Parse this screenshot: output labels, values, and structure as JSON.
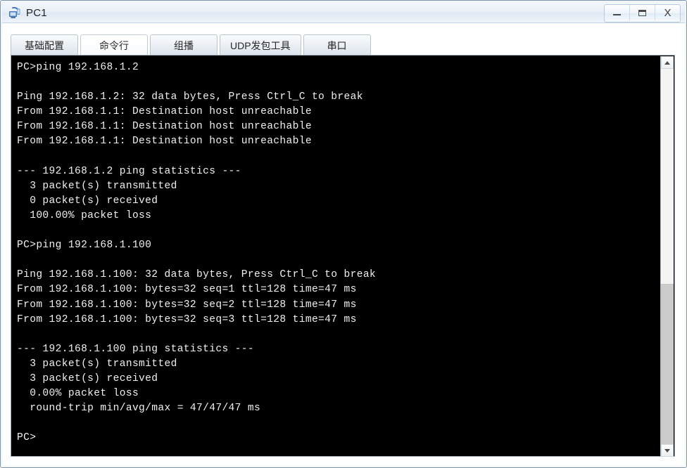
{
  "window": {
    "title": "PC1",
    "icon": "pc-terminal-icon",
    "controls": {
      "minimize": "–",
      "maximize": "❐",
      "close": "X"
    }
  },
  "tabs": [
    {
      "label": "基础配置",
      "name": "tab-basic-config",
      "selected": false
    },
    {
      "label": "命令行",
      "name": "tab-command-line",
      "selected": true
    },
    {
      "label": "组播",
      "name": "tab-multicast",
      "selected": false
    },
    {
      "label": "UDP发包工具",
      "name": "tab-udp-tool",
      "selected": false
    },
    {
      "label": "串口",
      "name": "tab-serial-port",
      "selected": false
    }
  ],
  "terminal": {
    "foreground": "#f0f0f0",
    "background": "#000000",
    "lines": [
      "PC>ping 192.168.1.2",
      "",
      "Ping 192.168.1.2: 32 data bytes, Press Ctrl_C to break",
      "From 192.168.1.1: Destination host unreachable",
      "From 192.168.1.1: Destination host unreachable",
      "From 192.168.1.1: Destination host unreachable",
      "",
      "--- 192.168.1.2 ping statistics ---",
      "  3 packet(s) transmitted",
      "  0 packet(s) received",
      "  100.00% packet loss",
      "",
      "PC>ping 192.168.1.100",
      "",
      "Ping 192.168.1.100: 32 data bytes, Press Ctrl_C to break",
      "From 192.168.1.100: bytes=32 seq=1 ttl=128 time=47 ms",
      "From 192.168.1.100: bytes=32 seq=2 ttl=128 time=47 ms",
      "From 192.168.1.100: bytes=32 seq=3 ttl=128 time=47 ms",
      "",
      "--- 192.168.1.100 ping statistics ---",
      "  3 packet(s) transmitted",
      "  3 packet(s) received",
      "  0.00% packet loss",
      "  round-trip min/avg/max = 47/47/47 ms",
      "",
      "PC>"
    ]
  },
  "scrollbar": {
    "up_arrow": "scroll-up-arrow",
    "down_arrow": "scroll-down-arrow"
  }
}
